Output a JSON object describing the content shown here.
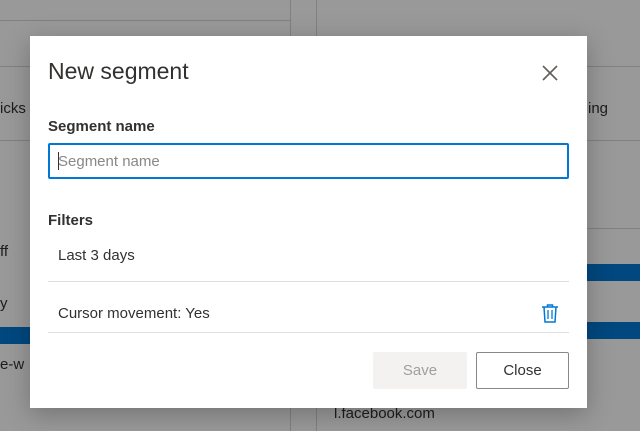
{
  "background": {
    "left_snippets": [
      "icks",
      "ff",
      "y",
      "e-w"
    ],
    "right_snippets": [
      "ing",
      "l.facebook.com"
    ]
  },
  "dialog": {
    "title": "New segment",
    "segment_name_label": "Segment name",
    "segment_name_placeholder": "Segment name",
    "segment_name_value": "",
    "filters_label": "Filters",
    "filters": [
      {
        "label": "Last 3 days"
      },
      {
        "label": "Cursor movement: Yes"
      }
    ],
    "save_label": "Save",
    "close_label": "Close"
  },
  "colors": {
    "accent": "#0078d4",
    "overlay": "rgba(0,0,0,0.40)"
  },
  "icons": {
    "close": "close-icon",
    "delete": "trash-icon"
  }
}
